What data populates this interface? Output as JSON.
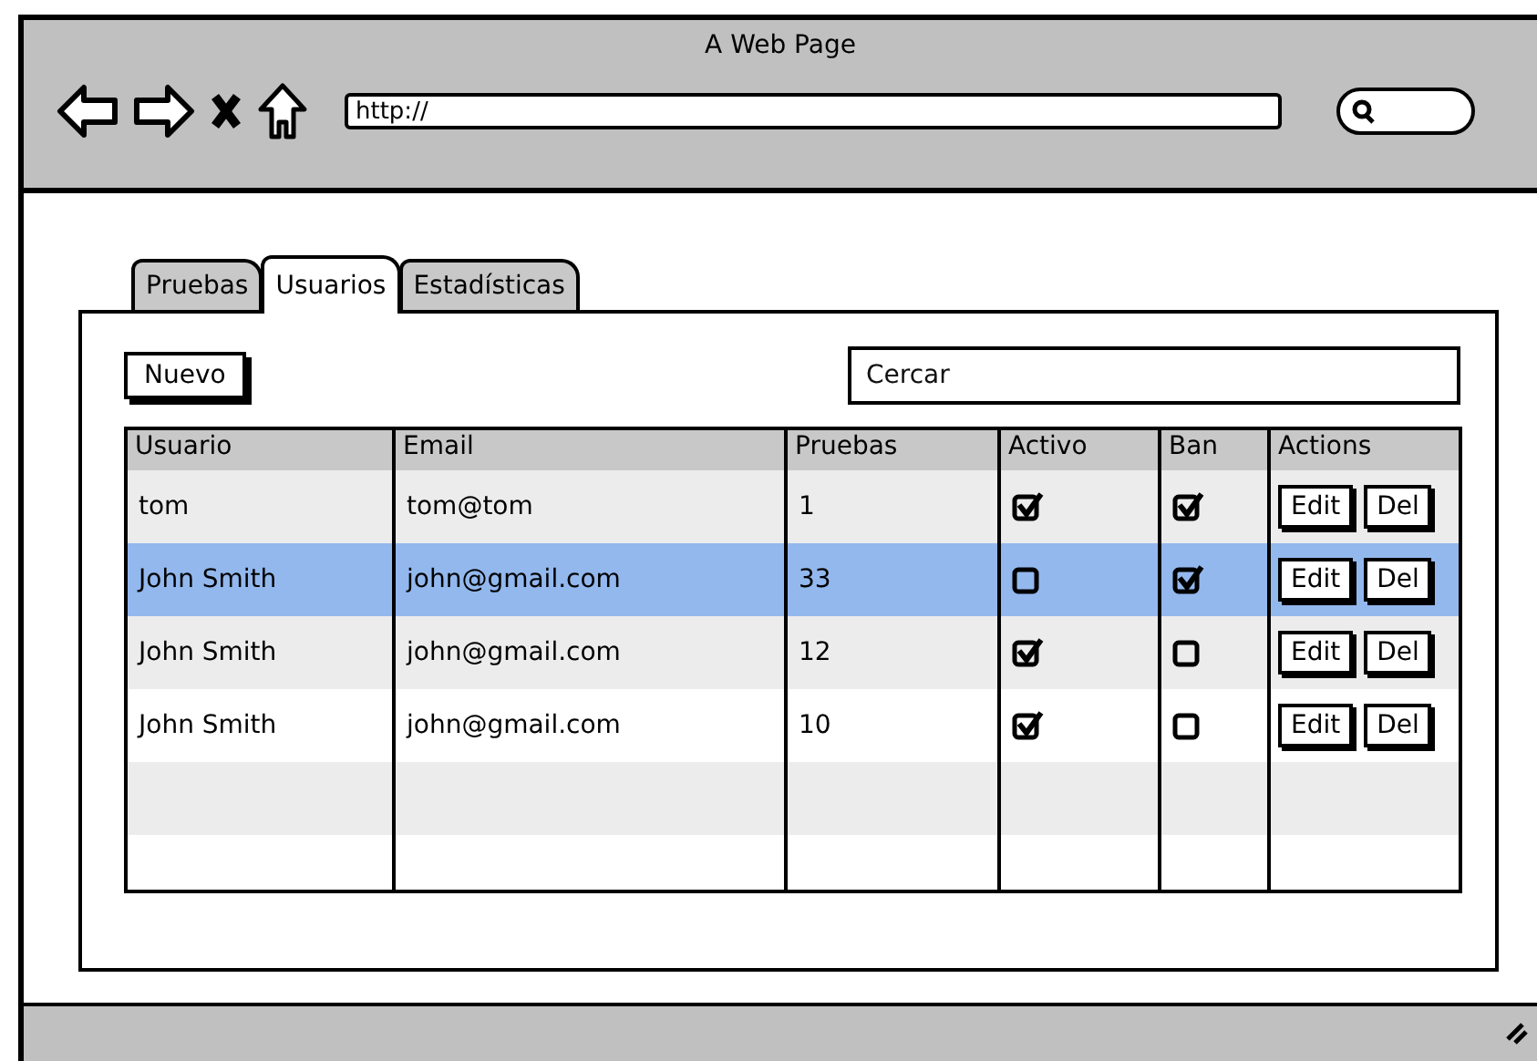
{
  "window": {
    "title": "A Web Page",
    "address": "http://"
  },
  "tabs": [
    {
      "label": "Pruebas",
      "selected": false
    },
    {
      "label": "Usuarios",
      "selected": true
    },
    {
      "label": "Estadísticas",
      "selected": false
    }
  ],
  "new_button": "Nuevo",
  "search": {
    "placeholder": "Cercar"
  },
  "table": {
    "columns": [
      "Usuario",
      "Email",
      "Pruebas",
      "Activo",
      "Ban",
      "Actions"
    ],
    "rows": [
      {
        "usuario": "tom",
        "email": "tom@tom",
        "pruebas": "1",
        "activo": true,
        "ban": true,
        "selected": false,
        "actions": [
          "Edit",
          "Del"
        ]
      },
      {
        "usuario": "John Smith",
        "email": "john@gmail.com",
        "pruebas": "33",
        "activo": false,
        "ban": true,
        "selected": true,
        "actions": [
          "Edit",
          "Del"
        ]
      },
      {
        "usuario": "John Smith",
        "email": "john@gmail.com",
        "pruebas": "12",
        "activo": true,
        "ban": false,
        "selected": false,
        "actions": [
          "Edit",
          "Del"
        ]
      },
      {
        "usuario": "John Smith",
        "email": "john@gmail.com",
        "pruebas": "10",
        "activo": true,
        "ban": false,
        "selected": false,
        "actions": [
          "Edit",
          "Del"
        ]
      }
    ]
  }
}
